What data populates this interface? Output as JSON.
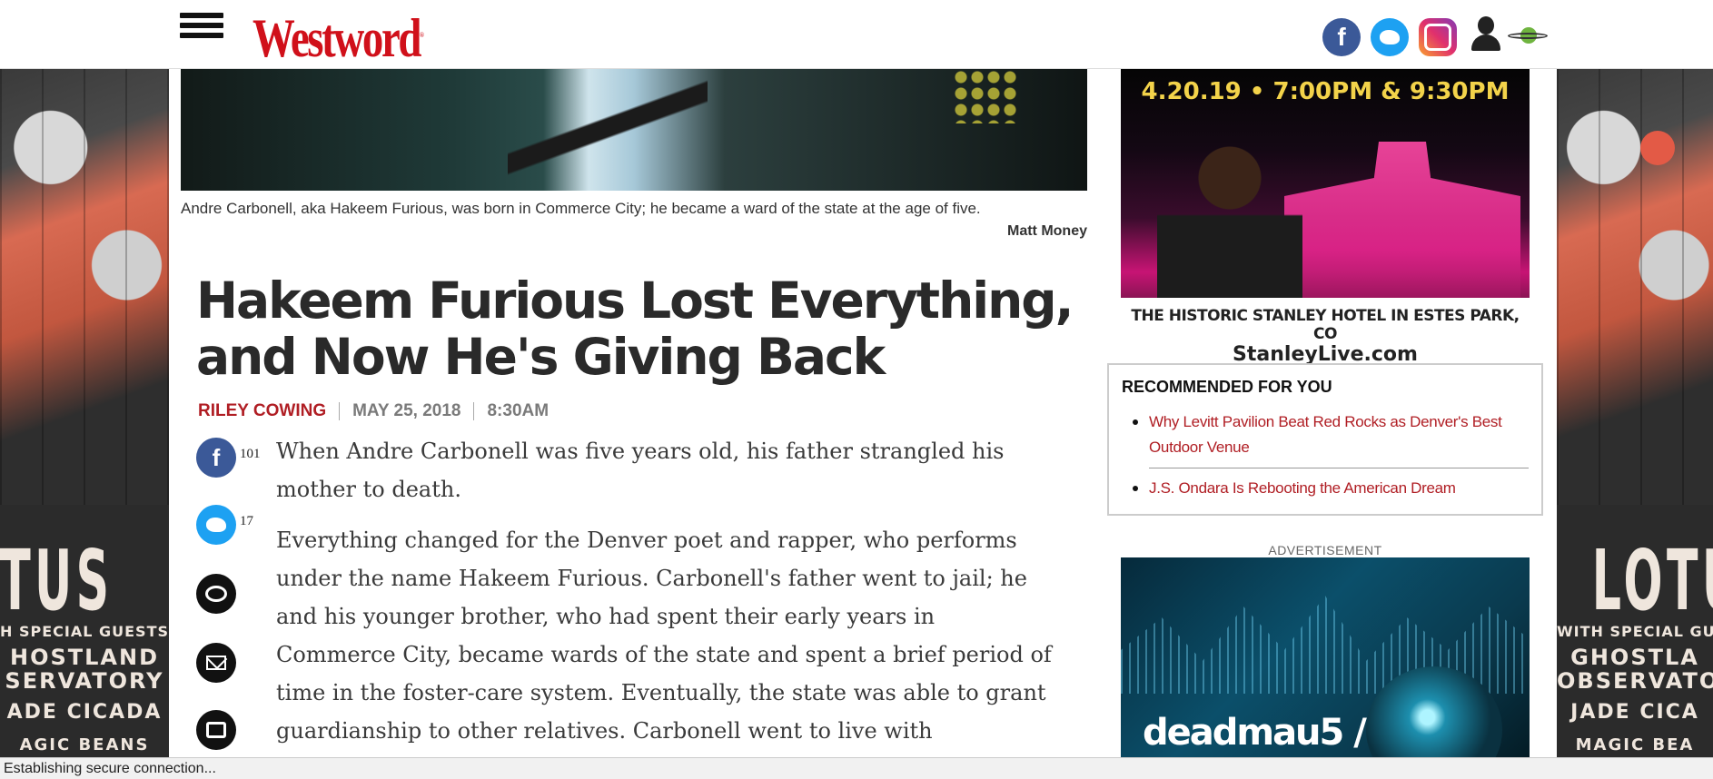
{
  "site": {
    "logo": "Westword",
    "logo_mark": "®"
  },
  "header": {
    "social": [
      {
        "name": "facebook",
        "icon": "facebook-icon",
        "glyph": "f"
      },
      {
        "name": "twitter",
        "icon": "twitter-icon"
      },
      {
        "name": "instagram",
        "icon": "instagram-icon"
      }
    ]
  },
  "skin_ad": {
    "headline": "LOTUS",
    "headline_left": "OTUS",
    "headline_right": "LOTU",
    "line1_left": "H SPECIAL GUESTS",
    "line1_right": "WITH SPECIAL GU",
    "line2_left": "HOSTLAND",
    "line2_right": "GHOSTLA",
    "line3_left": "SERVATORY",
    "line3_right": "OBSERVATO",
    "line4_left": "ADE CICADA",
    "line4_right": "JADE CICA",
    "line5_left": "AGIC BEANS",
    "line5_right": "MAGIC BEA"
  },
  "article": {
    "caption": "Andre Carbonell, aka Hakeem Furious, was born in Commerce City; he became a ward of the state at the age of five.",
    "photo_credit": "Matt Money",
    "headline": "Hakeem Furious Lost Everything, and Now He's Giving Back",
    "author": "RILEY COWING",
    "date": "MAY 25, 2018",
    "time": "8:30AM",
    "share": {
      "facebook_count": "101",
      "twitter_count": "17"
    },
    "paragraphs": [
      "When Andre Carbonell was five years old, his father strangled his mother to death.",
      "Everything changed for the Denver poet and rapper, who performs under the name Hakeem Furious. Carbonell's father went to jail; he and his younger brother, who had spent their early years in Commerce City, became wards of the state and spent a brief period of time in the foster-care system. Eventually, the state was able to grant guardianship to other relatives. Carbonell went to live with"
    ]
  },
  "sidebar": {
    "ad1": {
      "date_line": "4.20.19 • 7:00PM & 9:30PM",
      "venue_line": "THE HISTORIC STANLEY HOTEL IN ESTES PARK, CO",
      "url_line": "StanleyLive.com"
    },
    "recommended": {
      "title": "RECOMMENDED FOR YOU",
      "items": [
        "Why Levitt Pavilion Beat Red Rocks as Denver's Best Outdoor Venue",
        "J.S. Ondara Is Rebooting the American Dream"
      ]
    },
    "ad_label": "ADVERTISEMENT",
    "ad2": {
      "brand": "deadmau5 /"
    }
  },
  "status": "Establishing secure connection..."
}
